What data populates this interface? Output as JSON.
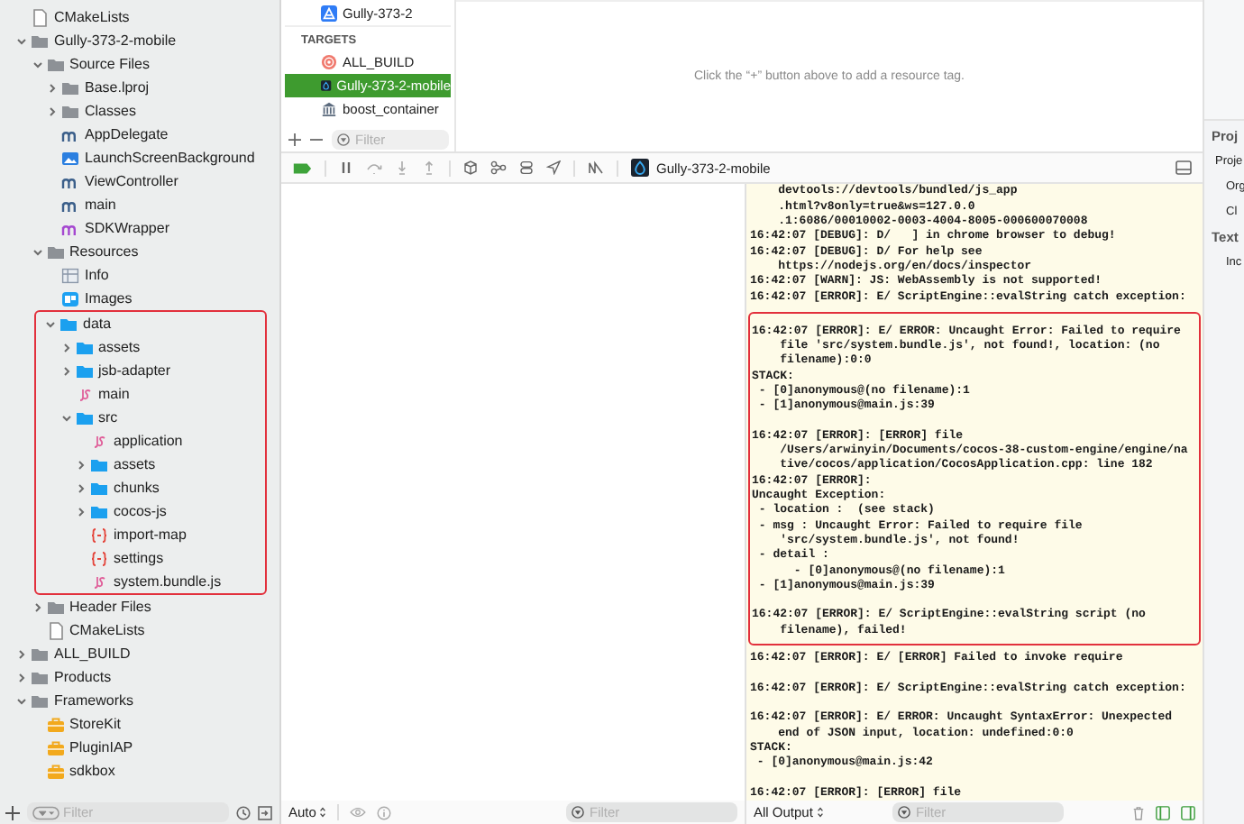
{
  "navigator": {
    "tree": [
      {
        "name": "CMakeLists",
        "kind": "file"
      },
      {
        "name": "Gully-373-2-mobile",
        "kind": "group",
        "expanded": true,
        "children": [
          {
            "name": "Source Files",
            "kind": "group",
            "expanded": true,
            "children": [
              {
                "name": "Base.lproj",
                "kind": "group",
                "expanded": false
              },
              {
                "name": "Classes",
                "kind": "group",
                "expanded": false
              },
              {
                "name": "AppDelegate",
                "kind": "objc"
              },
              {
                "name": "LaunchScreenBackground",
                "kind": "image"
              },
              {
                "name": "ViewController",
                "kind": "objc"
              },
              {
                "name": "main",
                "kind": "objc"
              },
              {
                "name": "SDKWrapper",
                "kind": "objcpp"
              }
            ]
          },
          {
            "name": "Resources",
            "kind": "group",
            "expanded": true,
            "children": [
              {
                "name": "Info",
                "kind": "plist"
              },
              {
                "name": "Images",
                "kind": "assets"
              },
              {
                "name": "data",
                "kind": "folder",
                "expanded": true,
                "highlighted": true,
                "children": [
                  {
                    "name": "assets",
                    "kind": "folder",
                    "expanded": false
                  },
                  {
                    "name": "jsb-adapter",
                    "kind": "folder",
                    "expanded": false
                  },
                  {
                    "name": "main",
                    "kind": "js"
                  },
                  {
                    "name": "src",
                    "kind": "folder",
                    "expanded": true,
                    "children": [
                      {
                        "name": "application",
                        "kind": "js"
                      },
                      {
                        "name": "assets",
                        "kind": "folder",
                        "expanded": false
                      },
                      {
                        "name": "chunks",
                        "kind": "folder",
                        "expanded": false
                      },
                      {
                        "name": "cocos-js",
                        "kind": "folder",
                        "expanded": false
                      },
                      {
                        "name": "import-map",
                        "kind": "json"
                      },
                      {
                        "name": "settings",
                        "kind": "json"
                      },
                      {
                        "name": "system.bundle.js",
                        "kind": "js"
                      }
                    ]
                  }
                ]
              }
            ]
          },
          {
            "name": "Header Files",
            "kind": "group",
            "expanded": false
          },
          {
            "name": "CMakeLists",
            "kind": "file"
          }
        ]
      },
      {
        "name": "ALL_BUILD",
        "kind": "group",
        "expanded": false
      },
      {
        "name": "Products",
        "kind": "group",
        "expanded": false
      },
      {
        "name": "Frameworks",
        "kind": "group",
        "expanded": true,
        "children": [
          {
            "name": "StoreKit",
            "kind": "framework"
          },
          {
            "name": "PluginIAP",
            "kind": "framework"
          },
          {
            "name": "sdkbox",
            "kind": "framework"
          }
        ]
      }
    ],
    "filter": {
      "placeholder": "Filter"
    }
  },
  "targets_panel": {
    "project": {
      "name": "Gully-373-2"
    },
    "section_title": "TARGETS",
    "targets": [
      {
        "name": "ALL_BUILD",
        "kind": "aggregate",
        "selected": false
      },
      {
        "name": "Gully-373-2-mobile",
        "kind": "app",
        "selected": true
      },
      {
        "name": "boost_container",
        "kind": "library",
        "selected": false
      }
    ],
    "filter": {
      "placeholder": "Filter"
    }
  },
  "resource_tags": {
    "hint": "Click the “+” button above to add a resource tag."
  },
  "debug_bar": {
    "breakpoints_active": true,
    "process": "Gully-373-2-mobile"
  },
  "variables": {
    "scope": "Auto",
    "filter": {
      "placeholder": "Filter"
    }
  },
  "console": {
    "groups": [
      {
        "highlighted": false,
        "paragraphs": [
          [
            {
              "wrap": [
                "devtools://devtools/bundled/js_app",
                ".html?v8only=true&ws=127.0.0",
                ".1:6086/00010002-0003-4004-8005-000600070008"
              ]
            },
            {
              "head": "16:42:07 [DEBUG]: D/   ] in chrome browser to debug!"
            },
            {
              "head": "16:42:07 [DEBUG]: D/ For help see",
              "wrap": [
                "https://nodejs.org/en/docs/inspector"
              ]
            },
            {
              "head": "16:42:07 [WARN]: JS: WebAssembly is not supported!"
            },
            {
              "head": "16:42:07 [ERROR]: E/ ScriptEngine::evalString catch exception:"
            }
          ]
        ]
      },
      {
        "highlighted": true,
        "paragraphs": [
          [
            {
              "head": "16:42:07 [ERROR]: E/ ERROR: Uncaught Error: Failed to require",
              "wrap": [
                "file 'src/system.bundle.js', not found!, location: (no",
                "filename):0:0"
              ]
            },
            {
              "head": "STACK:"
            },
            {
              "head": " - [0]anonymous@(no filename):1"
            },
            {
              "head": " - [1]anonymous@main.js:39"
            }
          ],
          [
            {
              "head": "16:42:07 [ERROR]: [ERROR] file",
              "wrap": [
                "/Users/arwinyin/Documents/cocos-38-custom-engine/engine/na",
                "tive/cocos/application/CocosApplication.cpp: line 182"
              ]
            },
            {
              "head": "16:42:07 [ERROR]:"
            },
            {
              "head": "Uncaught Exception:"
            },
            {
              "head": " - location :  (see stack)"
            },
            {
              "head": " - msg : Uncaught Error: Failed to require file",
              "wrap": [
                "'src/system.bundle.js', not found!"
              ]
            },
            {
              "head": " - detail :"
            },
            {
              "head": "      - [0]anonymous@(no filename):1"
            },
            {
              "head": " - [1]anonymous@main.js:39"
            }
          ],
          [
            {
              "head": "16:42:07 [ERROR]: E/ ScriptEngine::evalString script (no",
              "wrap": [
                "filename), failed!"
              ]
            }
          ]
        ]
      },
      {
        "highlighted": false,
        "paragraphs": [
          [
            {
              "head": "16:42:07 [ERROR]: E/ [ERROR] Failed to invoke require"
            }
          ],
          [
            {
              "head": "16:42:07 [ERROR]: E/ ScriptEngine::evalString catch exception:"
            }
          ],
          [
            {
              "head": "16:42:07 [ERROR]: E/ ERROR: Uncaught SyntaxError: Unexpected",
              "wrap": [
                "end of JSON input, location: undefined:0:0"
              ]
            },
            {
              "head": "STACK:"
            },
            {
              "head": " - [0]anonymous@main.js:42"
            }
          ],
          [
            {
              "head": "16:42:07 [ERROR]: [ERROR] file"
            }
          ]
        ]
      }
    ],
    "output": "All Output",
    "filter": {
      "placeholder": "Filter"
    }
  },
  "inspector": {
    "items": [
      {
        "kind": "header",
        "text": "Proj"
      },
      {
        "kind": "label",
        "text": "Proje"
      },
      {
        "kind": "sublabel",
        "text": "Org"
      },
      {
        "kind": "sublabel",
        "text": "Cl"
      },
      {
        "kind": "header",
        "text": "Text"
      },
      {
        "kind": "sublabel",
        "text": "Inc"
      }
    ]
  }
}
